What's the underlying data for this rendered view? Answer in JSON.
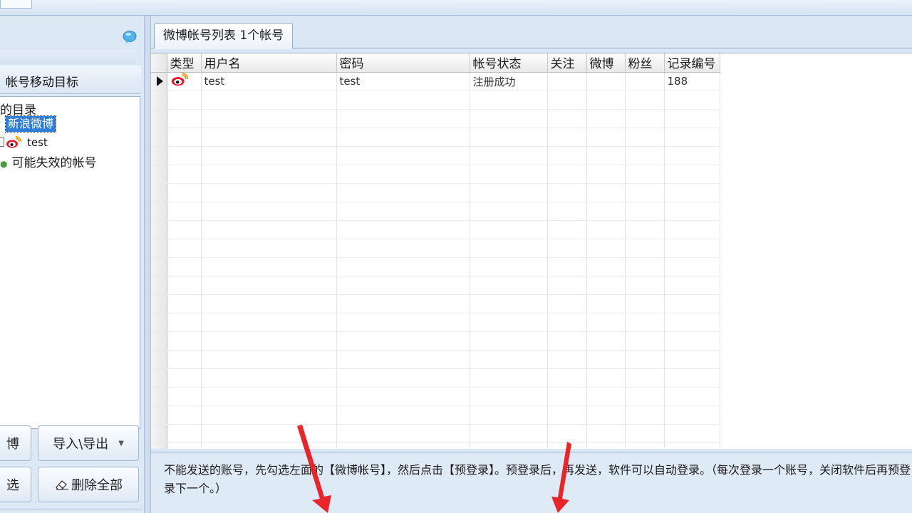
{
  "top_menu": {
    "tabs": [
      "",
      "",
      "",
      "",
      "",
      ""
    ]
  },
  "left_panel": {
    "subheader": "帐号移动目标",
    "tree": {
      "root": "的目录",
      "category": "新浪微博",
      "account": "test",
      "invalid": "可能失效的帐号"
    },
    "buttons": {
      "weibo": "博",
      "import_export": "导入\\导出",
      "select": "选",
      "delete_all": "删除全部"
    }
  },
  "account_list": {
    "tab_label": "微博帐号列表 1个帐号",
    "columns": [
      "类型",
      "用户名",
      "密码",
      "帐号状态",
      "关注",
      "微博",
      "粉丝",
      "记录编号"
    ],
    "rows": [
      {
        "username": "test",
        "password": "test",
        "status": "注册成功",
        "follow": "",
        "weibo": "",
        "fans": "",
        "record_id": "188"
      }
    ]
  },
  "info": {
    "text": "不能发送的账号，先勾选左面的【微博帐号】，然后点击【预登录】。预登录后，再发送，软件可以自动登录。（每次登录一个账号，关闭软件后再预登录下一个。）"
  },
  "colors": {
    "selection": "#2f7ed8",
    "arrow": "#e8262a",
    "weibo_red": "#e6162d"
  }
}
